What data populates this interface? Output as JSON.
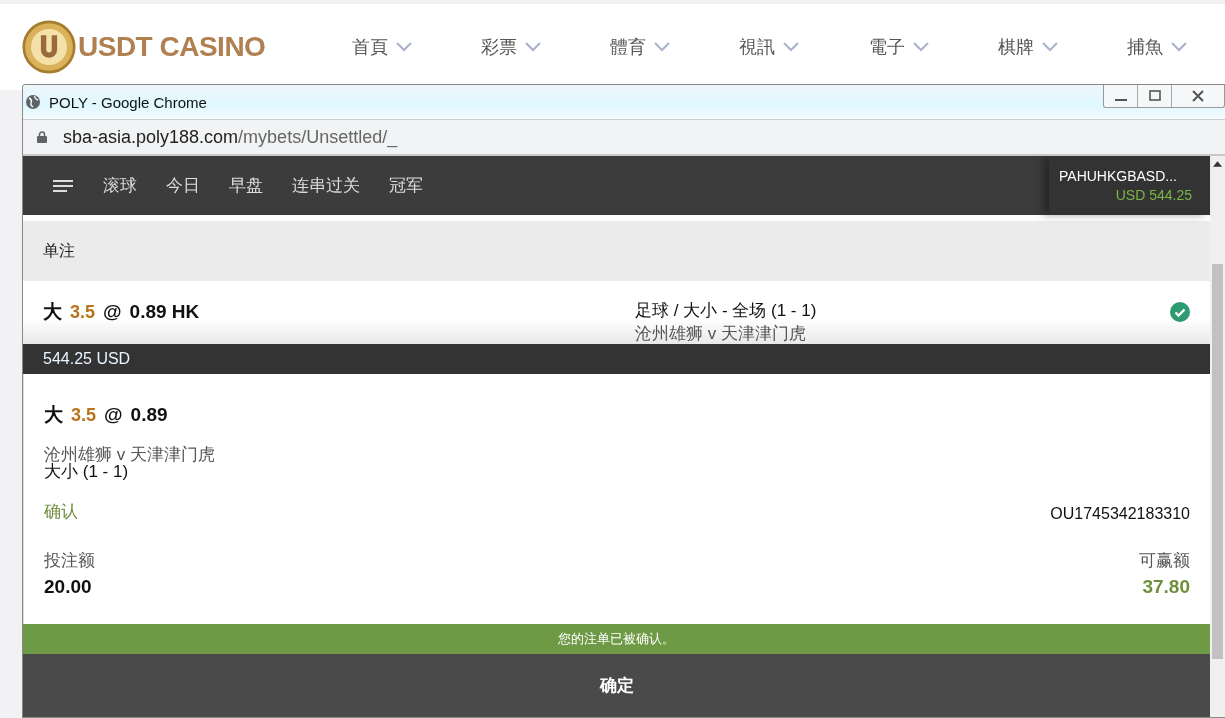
{
  "site": {
    "logo": "USDT CASINO",
    "nav": [
      "首頁",
      "彩票",
      "體育",
      "視訊",
      "電子",
      "棋牌",
      "捕魚"
    ]
  },
  "window": {
    "title": "POLY - Google Chrome",
    "url_host": "sba-asia.poly188.com",
    "url_path": "/mybets/Unsettled/_"
  },
  "app_nav": {
    "items": [
      "滚球",
      "今日",
      "早盘",
      "连串过关",
      "冠军"
    ],
    "account": "PAHUHKGBASD...",
    "balance": "USD 544.25"
  },
  "section": "单注",
  "bet": {
    "selection": "大",
    "line": "3.5",
    "at": "@",
    "odds": "0.89 HK",
    "market": "足球 / 大小 - 全场 (1 - 1)",
    "match": "沧州雄狮 v 天津津门虎",
    "confirmed": true
  },
  "overlay": {
    "balance": "544.25 USD",
    "selection": "大",
    "line": "3.5",
    "at": "@",
    "odds": "0.89",
    "match": "沧州雄狮 v 天津津门虎",
    "market": "大小 (1 - 1)",
    "status": "确认",
    "ref": "OU1745342183310",
    "stake_label": "投注额",
    "stake": "20.00",
    "win_label": "可赢额",
    "win": "37.80",
    "message": "您的注单已被确认。",
    "ok": "确定"
  }
}
